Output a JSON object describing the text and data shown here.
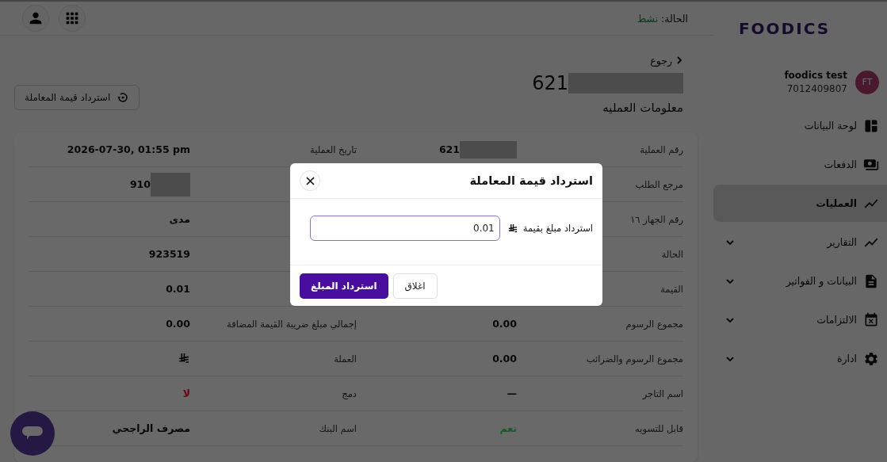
{
  "topbar": {
    "status_label": "الحالة:",
    "status_value": "نشط"
  },
  "sidebar": {
    "logo": "FOODICS",
    "user": {
      "initials": "FT",
      "name": "foodics test",
      "id": "7012409807"
    },
    "items": [
      {
        "label": "لوحة البيانات",
        "selected": false,
        "expandable": false
      },
      {
        "label": "الدفعات",
        "selected": false,
        "expandable": false
      },
      {
        "label": "العمليات",
        "selected": true,
        "expandable": false
      },
      {
        "label": "التقارير",
        "selected": false,
        "expandable": true
      },
      {
        "label": "البيانات و الفواتير",
        "selected": false,
        "expandable": true
      },
      {
        "label": "الالتزامات",
        "selected": false,
        "expandable": true
      },
      {
        "label": "ادارة",
        "selected": false,
        "expandable": true
      }
    ]
  },
  "header": {
    "back": "رجوع",
    "title": "621",
    "title_redacted": true,
    "subtitle": "معلومات العمليه",
    "refund_button": "استرداد قيمة المعاملة"
  },
  "details": {
    "rows": [
      {
        "label_a": "رقم العملية",
        "value_a": {
          "kind": "text",
          "text": "621",
          "redacted": true
        },
        "label_b": "تاريخ العملية",
        "value_b": {
          "kind": "text",
          "text": "2026-07-30, 01:55 pm"
        }
      },
      {
        "label_a": "مرجع الطلب",
        "value_b": {
          "kind": "text",
          "text": "910",
          "redacted": true
        }
      },
      {
        "label_a": "رقم الجهاز ١٦",
        "value_b": {
          "kind": "text",
          "text": "مدى"
        }
      },
      {
        "label_a": "الحالة",
        "value_b": {
          "kind": "text",
          "text": "923519"
        }
      },
      {
        "label_a": "القيمة",
        "value_b": {
          "kind": "text",
          "text": "0.01"
        }
      },
      {
        "label_a": "مجموع الرسوم",
        "value_a": {
          "kind": "text",
          "text": "0.00"
        },
        "label_b": "إجمالي مبلغ ضريبة القيمة المضافة",
        "value_b": {
          "kind": "text",
          "text": "0.00"
        }
      },
      {
        "label_a": "مجموع الرسوم والضرائب",
        "value_a": {
          "kind": "text",
          "text": "0.00"
        },
        "label_b": "العملة",
        "value_b": {
          "kind": "currency"
        }
      },
      {
        "label_a": "اسم التاجر",
        "value_a": {
          "kind": "text",
          "text": "—"
        },
        "label_b": "دمج",
        "value_b": {
          "kind": "text",
          "text": "لا",
          "color": "#6a0616"
        }
      },
      {
        "label_a": "قابل للتسويه",
        "value_a": {
          "kind": "text",
          "text": "نعم",
          "color": "#135a26"
        },
        "label_b": "اسم البنك",
        "value_b": {
          "kind": "text",
          "text": "مصرف الراجحي"
        }
      }
    ]
  },
  "modal": {
    "title": "استرداد قيمة المعاملة",
    "field_label": "استرداد مبلغ بقيمة",
    "amount": "0.01",
    "buttons": [
      {
        "label": "اغلاق",
        "kind": "secondary"
      },
      {
        "label": "استرداد المبلغ",
        "kind": "primary"
      }
    ]
  }
}
